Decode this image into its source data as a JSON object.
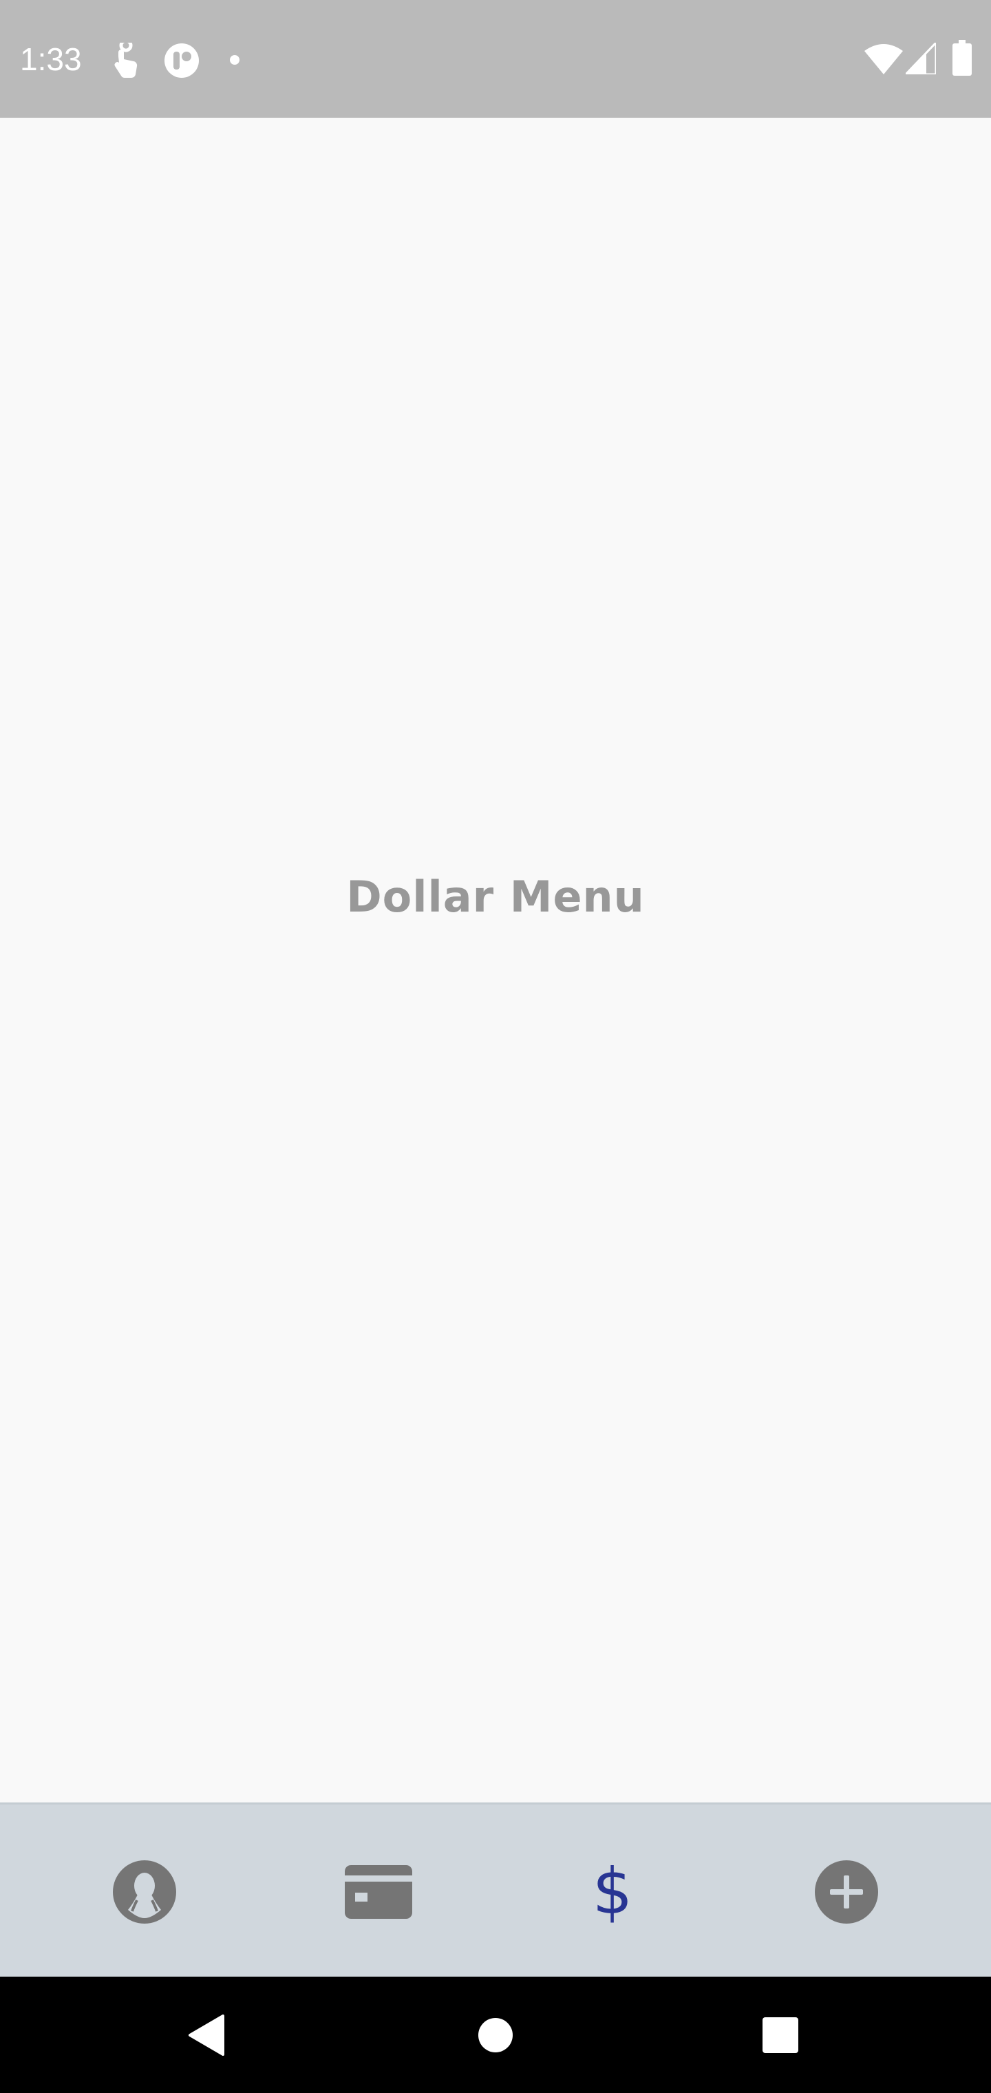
{
  "status_bar": {
    "time": "1:33",
    "icons": [
      "touch-icon",
      "app-badge-icon",
      "notification-dot-icon",
      "wifi-icon",
      "cell-signal-icon",
      "battery-icon"
    ]
  },
  "main": {
    "title": "Dollar Menu"
  },
  "bottom_nav": {
    "items": [
      {
        "icon": "profile-icon",
        "active": false
      },
      {
        "icon": "credit-card-icon",
        "active": false
      },
      {
        "icon": "dollar-icon",
        "glyph": "$",
        "active": true
      },
      {
        "icon": "add-circle-icon",
        "active": false
      }
    ],
    "active_color": "#283593",
    "inactive_color": "#757575",
    "background": "#d0d7dd"
  },
  "system_nav": {
    "buttons": [
      "back-icon",
      "home-icon",
      "recents-icon"
    ]
  },
  "colors": {
    "status_bar": "#bababa",
    "page_background": "#f9f9f9",
    "title": "#989898"
  }
}
